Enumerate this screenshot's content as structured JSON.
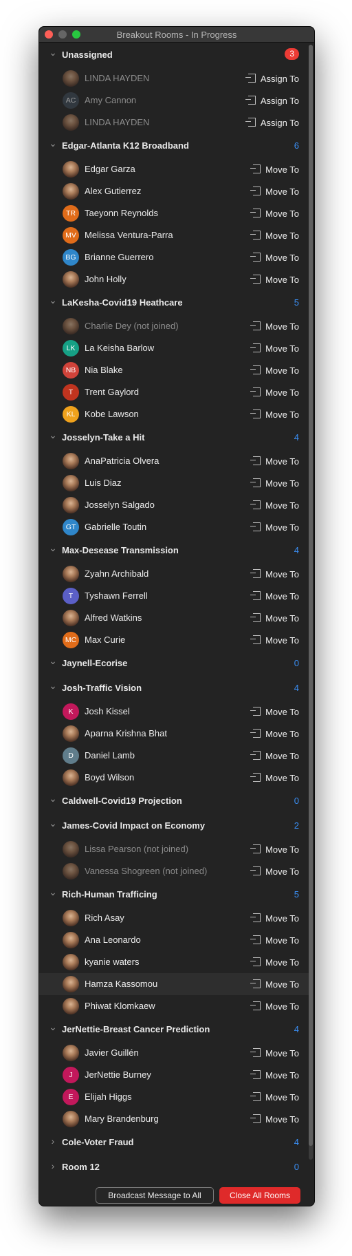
{
  "window": {
    "title": "Breakout Rooms - In Progress"
  },
  "colors": {
    "accent": "#3a8ff5",
    "danger": "#df2a2a",
    "badge": "#ec3b35",
    "background": "#232323"
  },
  "rooms": [
    {
      "name": "Unassigned",
      "count": "3",
      "expanded": true,
      "badge": true,
      "members": [
        {
          "name": "LINDA HAYDEN",
          "action": "Assign To",
          "dim": true,
          "avatar": "photo"
        },
        {
          "name": "Amy Cannon",
          "action": "Assign To",
          "dim": true,
          "avatar": "AC",
          "color": "#3e4a57"
        },
        {
          "name": "LINDA HAYDEN",
          "action": "Assign To",
          "dim": true,
          "avatar": "photo"
        }
      ]
    },
    {
      "name": "Edgar-Atlanta K12 Broadband",
      "count": "6",
      "expanded": true,
      "members": [
        {
          "name": "Edgar Garza",
          "action": "Move To",
          "avatar": "photo"
        },
        {
          "name": "Alex Gutierrez",
          "action": "Move To",
          "avatar": "photo"
        },
        {
          "name": "Taeyonn Reynolds",
          "action": "Move To",
          "avatar": "TR",
          "color": "#e06c1a"
        },
        {
          "name": "Melissa Ventura-Parra",
          "action": "Move To",
          "avatar": "MV",
          "color": "#e06c1a"
        },
        {
          "name": "Brianne Guerrero",
          "action": "Move To",
          "avatar": "BG",
          "color": "#2f86c9"
        },
        {
          "name": "John Holly",
          "action": "Move To",
          "avatar": "photo"
        }
      ]
    },
    {
      "name": "LaKesha-Covid19 Heathcare",
      "count": "5",
      "expanded": true,
      "members": [
        {
          "name": "Charlie Dey (not joined)",
          "action": "Move To",
          "dim": true,
          "avatar": "photo"
        },
        {
          "name": "La Keisha Barlow",
          "action": "Move To",
          "avatar": "LK",
          "color": "#16a085"
        },
        {
          "name": "Nia Blake",
          "action": "Move To",
          "avatar": "NB",
          "color": "#d0433a"
        },
        {
          "name": "Trent Gaylord",
          "action": "Move To",
          "avatar": "T",
          "color": "#c0341f"
        },
        {
          "name": "Kobe Lawson",
          "action": "Move To",
          "avatar": "KL",
          "color": "#f0a21c"
        }
      ]
    },
    {
      "name": "Josselyn-Take a Hit",
      "count": "4",
      "expanded": true,
      "members": [
        {
          "name": "AnaPatricia Olvera",
          "action": "Move To",
          "avatar": "photo"
        },
        {
          "name": "Luis Diaz",
          "action": "Move To",
          "avatar": "photo"
        },
        {
          "name": "Josselyn Salgado",
          "action": "Move To",
          "avatar": "photo"
        },
        {
          "name": "Gabrielle Toutin",
          "action": "Move To",
          "avatar": "GT",
          "color": "#2f86c9"
        }
      ]
    },
    {
      "name": "Max-Desease Transmission",
      "count": "4",
      "expanded": true,
      "members": [
        {
          "name": "Zyahn Archibald",
          "action": "Move To",
          "avatar": "photo"
        },
        {
          "name": "Tyshawn Ferrell",
          "action": "Move To",
          "avatar": "T",
          "color": "#5b5fc7"
        },
        {
          "name": "Alfred Watkins",
          "action": "Move To",
          "avatar": "photo"
        },
        {
          "name": "Max Curie",
          "action": "Move To",
          "avatar": "MC",
          "color": "#e06c1a"
        }
      ]
    },
    {
      "name": "Jaynell-Ecorise",
      "count": "0",
      "expanded": true,
      "members": []
    },
    {
      "name": "Josh-Traffic Vision",
      "count": "4",
      "expanded": true,
      "members": [
        {
          "name": "Josh Kissel",
          "action": "Move To",
          "avatar": "K",
          "color": "#c2185b"
        },
        {
          "name": "Aparna Krishna Bhat",
          "action": "Move To",
          "avatar": "photo"
        },
        {
          "name": "Daniel Lamb",
          "action": "Move To",
          "avatar": "D",
          "color": "#607d8b"
        },
        {
          "name": "Boyd Wilson",
          "action": "Move To",
          "avatar": "photo"
        }
      ]
    },
    {
      "name": "Caldwell-Covid19 Projection",
      "count": "0",
      "expanded": true,
      "members": []
    },
    {
      "name": "James-Covid Impact on Economy",
      "count": "2",
      "expanded": true,
      "members": [
        {
          "name": "Lissa Pearson (not joined)",
          "action": "Move To",
          "dim": true,
          "avatar": "photo"
        },
        {
          "name": "Vanessa Shogreen (not joined)",
          "action": "Move To",
          "dim": true,
          "avatar": "photo"
        }
      ]
    },
    {
      "name": "Rich-Human Trafficing",
      "count": "5",
      "expanded": true,
      "members": [
        {
          "name": "Rich Asay",
          "action": "Move To",
          "avatar": "photo"
        },
        {
          "name": "Ana Leonardo",
          "action": "Move To",
          "avatar": "photo"
        },
        {
          "name": "kyanie waters",
          "action": "Move To",
          "avatar": "photo"
        },
        {
          "name": "Hamza Kassomou",
          "action": "Move To",
          "avatar": "photo",
          "highlight": true
        },
        {
          "name": "Phiwat Klomkaew",
          "action": "Move To",
          "avatar": "photo"
        }
      ]
    },
    {
      "name": "JerNettie-Breast Cancer Prediction",
      "count": "4",
      "expanded": true,
      "members": [
        {
          "name": "Javier Guillén",
          "action": "Move To",
          "avatar": "photo"
        },
        {
          "name": "JerNettie Burney",
          "action": "Move To",
          "avatar": "J",
          "color": "#c2185b"
        },
        {
          "name": "Elijah Higgs",
          "action": "Move To",
          "avatar": "E",
          "color": "#c2185b"
        },
        {
          "name": "Mary Brandenburg",
          "action": "Move To",
          "avatar": "photo"
        }
      ]
    },
    {
      "name": "Cole-Voter Fraud",
      "count": "4",
      "expanded": false,
      "members": []
    },
    {
      "name": "Room 12",
      "count": "0",
      "expanded": false,
      "members": []
    }
  ],
  "footer": {
    "broadcast_label": "Broadcast Message to All",
    "close_all_label": "Close All Rooms"
  }
}
